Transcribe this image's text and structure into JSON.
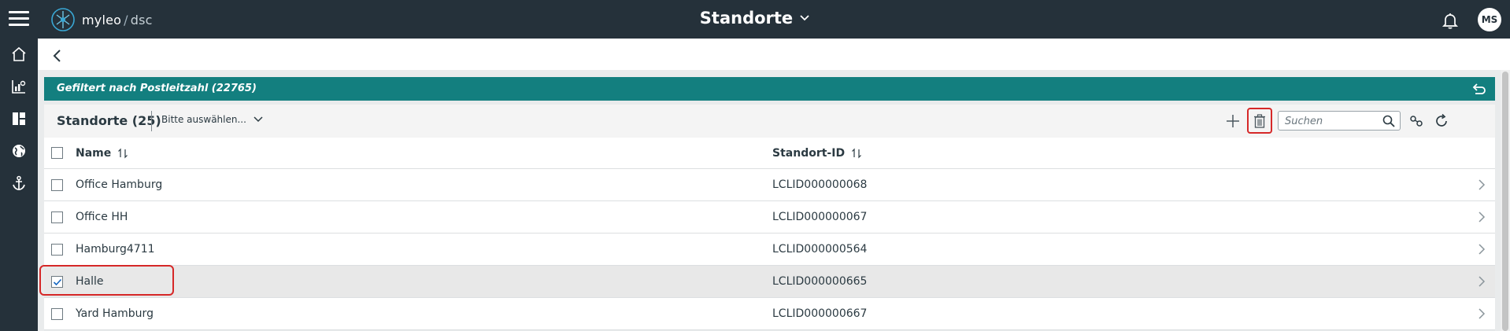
{
  "header": {
    "logo_name": "myleo",
    "logo_separator": "/",
    "logo_product": "dsc",
    "title": "Standorte",
    "avatar_initials": "MS"
  },
  "sidebar": {
    "items": [
      {
        "icon": "home-icon"
      },
      {
        "icon": "analytics-icon"
      },
      {
        "icon": "dashboard-icon"
      },
      {
        "icon": "globe-icon"
      },
      {
        "icon": "anchor-icon"
      }
    ]
  },
  "filter": {
    "text": "Gefiltert nach Postleitzahl (22765)"
  },
  "toolbar": {
    "count_label": "Standorte (25)",
    "selector_label": "Bitte auswählen...",
    "search_placeholder": "Suchen"
  },
  "table": {
    "columns": [
      "Name",
      "Standort-ID"
    ],
    "rows": [
      {
        "name": "Office Hamburg",
        "id": "LCLID000000068",
        "checked": false
      },
      {
        "name": "Office HH",
        "id": "LCLID000000067",
        "checked": false
      },
      {
        "name": "Hamburg4711",
        "id": "LCLID000000564",
        "checked": false
      },
      {
        "name": "Halle",
        "id": "LCLID000000665",
        "checked": true
      },
      {
        "name": "Yard Hamburg",
        "id": "LCLID000000667",
        "checked": false
      }
    ]
  },
  "colors": {
    "topbar": "#25313a",
    "filter_banner": "#137f7f",
    "highlight": "#d62828",
    "check": "#1565c0"
  }
}
